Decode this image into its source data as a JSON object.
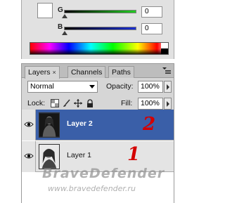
{
  "color_panel": {
    "channels": [
      {
        "label": "G",
        "value": "0",
        "track_color": "#22cc22",
        "handle_position": 0
      },
      {
        "label": "B",
        "value": "0",
        "track_color": "#1a2fd4",
        "handle_position": 0
      }
    ],
    "foreground_swatch_color": "#ffffff"
  },
  "layers_panel": {
    "tabs": [
      {
        "label": "Layers",
        "active": true,
        "closable": true,
        "close_glyph": "×"
      },
      {
        "label": "Channels",
        "active": false
      },
      {
        "label": "Paths",
        "active": false
      }
    ],
    "blend_mode": "Normal",
    "opacity_label": "Opacity:",
    "opacity_value": "100%",
    "lock_label": "Lock:",
    "fill_label": "Fill:",
    "fill_value": "100%",
    "lock_icons": [
      "lock-transparent-icon",
      "lock-paint-brush-icon",
      "lock-move-icon",
      "lock-all-icon"
    ],
    "layers": [
      {
        "name": "Layer 2",
        "selected": true,
        "visible": true
      },
      {
        "name": "Layer 1",
        "selected": false,
        "visible": true
      }
    ],
    "selected_row_color": "#3a5fa8"
  },
  "annotations": {
    "layer_2_number": "2",
    "layer_1_number": "1",
    "color": "#d40000"
  },
  "watermark": {
    "brand": "BraveDefender",
    "url": "www.bravedefender.ru"
  }
}
